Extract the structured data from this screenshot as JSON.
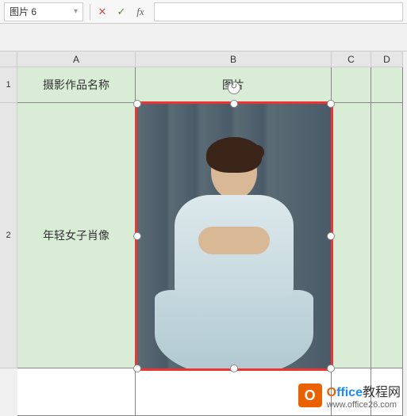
{
  "formula_bar": {
    "name_box": "图片 6",
    "cancel": "✕",
    "confirm": "✓",
    "fx": "fx"
  },
  "columns": [
    "A",
    "B",
    "C",
    "D"
  ],
  "rows": [
    "1",
    "2"
  ],
  "cells": {
    "a1": "摄影作品名称",
    "b1": "图片",
    "a2": "年轻女子肖像"
  },
  "watermark": {
    "icon": "O",
    "brand_o": "O",
    "brand_rest": "ffice",
    "brand_cn": "教程网",
    "url": "www.office26.com"
  }
}
